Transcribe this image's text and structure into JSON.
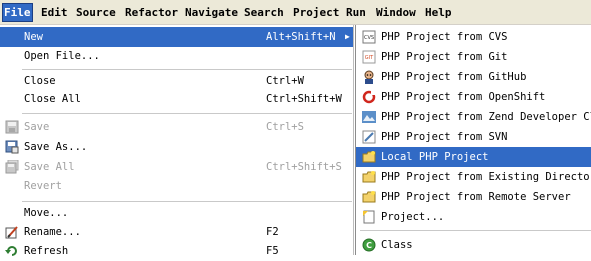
{
  "menubar": [
    {
      "key": "file",
      "label": "File"
    },
    {
      "key": "edit",
      "label": "Edit"
    },
    {
      "key": "source",
      "label": "Source"
    },
    {
      "key": "refactor",
      "label": "Refactor"
    },
    {
      "key": "navigate",
      "label": "Navigate"
    },
    {
      "key": "search",
      "label": "Search"
    },
    {
      "key": "project",
      "label": "Project"
    },
    {
      "key": "run",
      "label": "Run"
    },
    {
      "key": "window",
      "label": "Window"
    },
    {
      "key": "help",
      "label": "Help"
    }
  ],
  "file_menu": {
    "new": {
      "label": "New",
      "accel": "Alt+Shift+N"
    },
    "open_file": {
      "label": "Open File..."
    },
    "close": {
      "label": "Close",
      "accel": "Ctrl+W"
    },
    "close_all": {
      "label": "Close All",
      "accel": "Ctrl+Shift+W"
    },
    "save": {
      "label": "Save",
      "accel": "Ctrl+S"
    },
    "save_as": {
      "label": "Save As..."
    },
    "save_all": {
      "label": "Save All",
      "accel": "Ctrl+Shift+S"
    },
    "revert": {
      "label": "Revert"
    },
    "move": {
      "label": "Move..."
    },
    "rename": {
      "label": "Rename...",
      "accel": "F2"
    },
    "refresh": {
      "label": "Refresh",
      "accel": "F5"
    }
  },
  "new_submenu": [
    {
      "label": "PHP Project from CVS",
      "icon": "cvs-icon"
    },
    {
      "label": "PHP Project from Git",
      "icon": "git-icon"
    },
    {
      "label": "PHP Project from GitHub",
      "icon": "github-icon"
    },
    {
      "label": "PHP Project from OpenShift",
      "icon": "openshift-icon"
    },
    {
      "label": "PHP Project from Zend Developer Cloud",
      "icon": "zend-cloud-icon"
    },
    {
      "label": "PHP Project from SVN",
      "icon": "svn-icon"
    },
    {
      "label": "Local PHP Project",
      "icon": "php-project-icon"
    },
    {
      "label": "PHP Project from Existing Directory",
      "icon": "php-project-icon"
    },
    {
      "label": "PHP Project from Remote Server",
      "icon": "php-project-icon"
    },
    {
      "label": "Project...",
      "icon": "project-icon"
    },
    {
      "label": "Class",
      "icon": "class-icon"
    }
  ],
  "colors": {
    "highlight": "#316ac5",
    "menubar_bg": "#ece9d8",
    "disabled_text": "#a0a0a0"
  }
}
